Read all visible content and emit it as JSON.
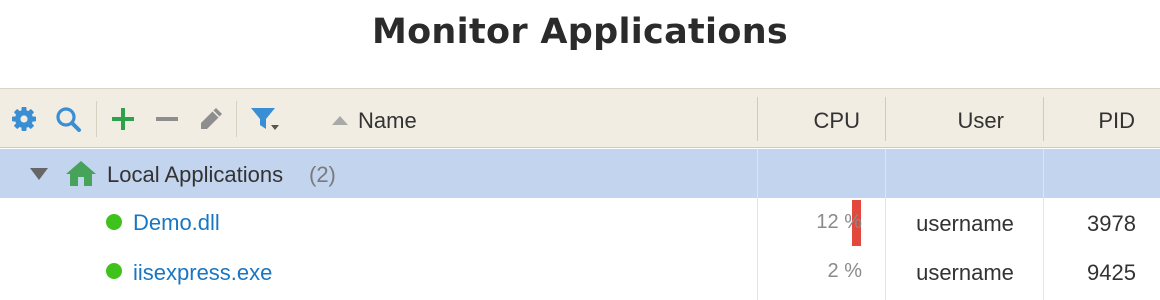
{
  "title": "Monitor Applications",
  "toolbar": {
    "icons": [
      "gear-icon",
      "search-icon",
      "plus-icon",
      "minus-icon",
      "pencil-icon",
      "filter-icon"
    ]
  },
  "columns": {
    "name": "Name",
    "cpu": "CPU",
    "user": "User",
    "pid": "PID"
  },
  "colors": {
    "header_bg": "#f1ede2",
    "group_bg": "#c2d4ee",
    "link": "#1a76c2",
    "status_running": "#3fc31c",
    "cpu_bar": "#e2483b",
    "icon_blue": "#3a8fd4",
    "icon_green": "#2ea24a",
    "icon_gray": "#8e8e8e"
  },
  "group": {
    "label": "Local Applications",
    "count": "(2)"
  },
  "apps": [
    {
      "name": "Demo.dll",
      "cpu": "12 %",
      "cpu_fraction": 0.12,
      "user": "username",
      "pid": "3978"
    },
    {
      "name": "iisexpress.exe",
      "cpu": "2 %",
      "cpu_fraction": 0.02,
      "user": "username",
      "pid": "9425"
    }
  ]
}
